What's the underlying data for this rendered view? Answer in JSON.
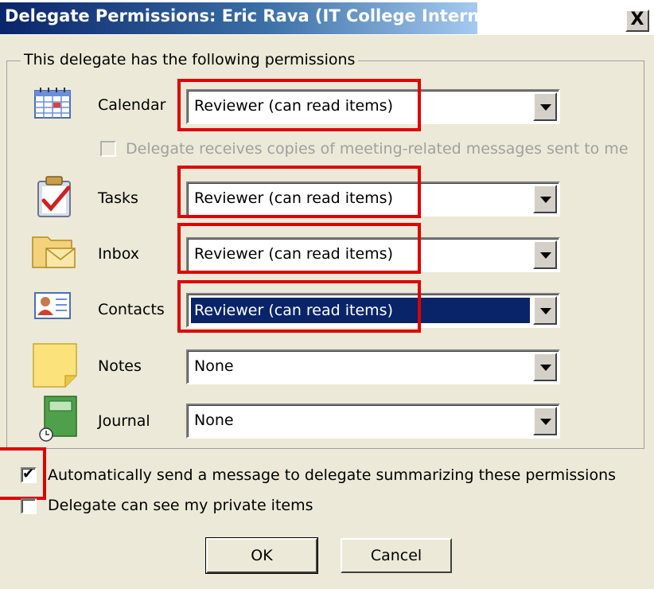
{
  "window": {
    "title": "Delegate Permissions: Eric Rava (IT College Intern)",
    "close_label": "X"
  },
  "group": {
    "label": "This delegate has the following permissions"
  },
  "rows": [
    {
      "label": "Calendar",
      "value": "Reviewer (can read items)",
      "icon": "calendar-icon"
    },
    {
      "label": "Tasks",
      "value": "Reviewer (can read items)",
      "icon": "tasks-icon"
    },
    {
      "label": "Inbox",
      "value": "Reviewer (can read items)",
      "icon": "inbox-icon"
    },
    {
      "label": "Contacts",
      "value": "Reviewer (can read items)",
      "icon": "contacts-icon",
      "selected": true
    },
    {
      "label": "Notes",
      "value": "None",
      "icon": "notes-icon"
    },
    {
      "label": "Journal",
      "value": "None",
      "icon": "journal-icon"
    }
  ],
  "checkboxes": {
    "meeting_copies": {
      "label": "Delegate receives copies of meeting-related messages sent to me",
      "checked": false,
      "disabled": true
    },
    "auto_send": {
      "label": "Automatically send a message to delegate summarizing these permissions",
      "checked": true
    },
    "private_items": {
      "label": "Delegate can see my private items",
      "checked": false
    }
  },
  "buttons": {
    "ok": "OK",
    "cancel": "Cancel"
  },
  "colors": {
    "dialog_bg": "#ECE9D8",
    "title_bar": "#0A246A",
    "highlight": "#0A246A",
    "annotation_red": "#E00000"
  }
}
